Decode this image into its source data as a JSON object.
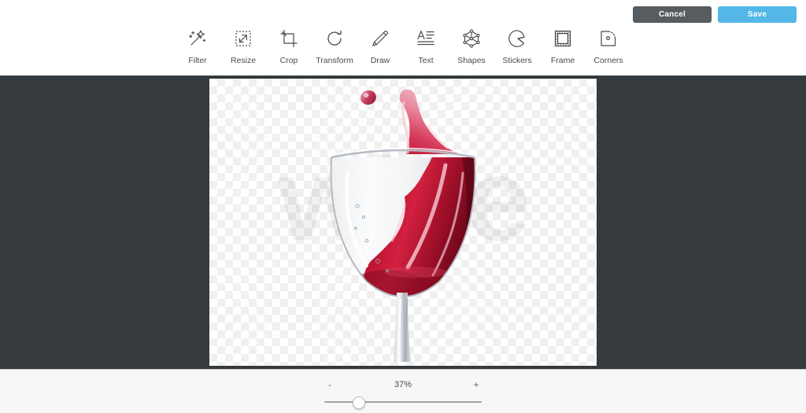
{
  "header": {
    "cancel_label": "Cancel",
    "save_label": "Save",
    "cancel_color": "#575c60",
    "save_color": "#54b7e8"
  },
  "toolbar": {
    "tools": [
      {
        "id": "filter",
        "label": "Filter",
        "icon": "magic-wand-icon"
      },
      {
        "id": "resize",
        "label": "Resize",
        "icon": "resize-arrow-icon"
      },
      {
        "id": "crop",
        "label": "Crop",
        "icon": "crop-icon"
      },
      {
        "id": "transform",
        "label": "Transform",
        "icon": "rotate-icon"
      },
      {
        "id": "draw",
        "label": "Draw",
        "icon": "pencil-icon"
      },
      {
        "id": "text",
        "label": "Text",
        "icon": "text-lines-icon"
      },
      {
        "id": "shapes",
        "label": "Shapes",
        "icon": "polygon-nodes-icon"
      },
      {
        "id": "stickers",
        "label": "Stickers",
        "icon": "sticker-peel-icon"
      },
      {
        "id": "frame",
        "label": "Frame",
        "icon": "frame-square-icon"
      },
      {
        "id": "corners",
        "label": "Corners",
        "icon": "rounded-corner-icon"
      }
    ]
  },
  "canvas": {
    "watermark_text": "wine",
    "image_subject": "wine-glass-splash-photo",
    "background_color": "#343a3d",
    "transparency_checkerboard": true
  },
  "footer": {
    "zoom_out_label": "-",
    "zoom_in_label": "+",
    "zoom_value": "37%",
    "slider_percent": 21.5
  }
}
